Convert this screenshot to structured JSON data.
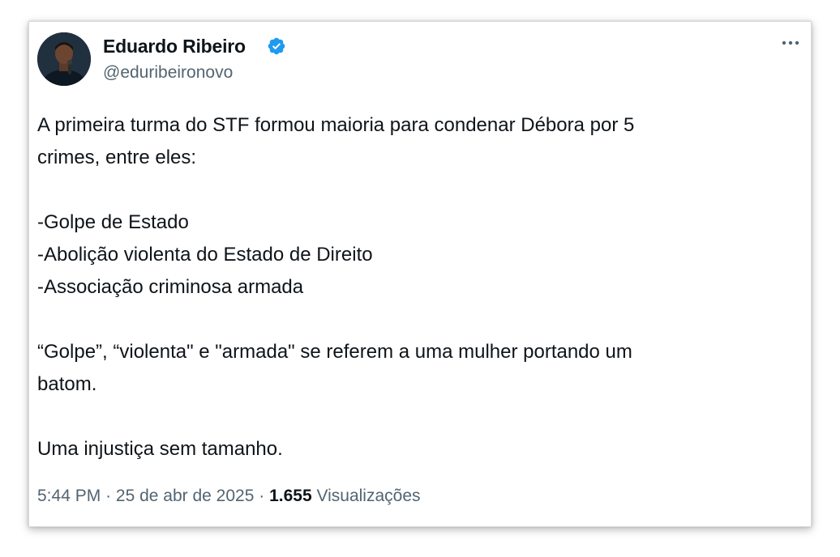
{
  "author": {
    "display_name": "Eduardo Ribeiro",
    "handle": "@eduribeironovo",
    "verified": true,
    "avatar_icon": "profile-photo-avatar"
  },
  "menu_icon": "more-horizontal-icon",
  "tweet": {
    "lines": [
      "A primeira turma do STF formou maioria para condenar Débora por 5",
      "crimes, entre eles:",
      "",
      "-Golpe de Estado",
      "-Abolição violenta do Estado de Direito",
      "-Associação criminosa armada",
      "",
      "“Golpe”, “violenta\" e \"armada\" se referem a uma mulher portando um",
      "batom.",
      "",
      "Uma injustiça sem tamanho."
    ]
  },
  "meta": {
    "time": "5:44 PM",
    "separator": "·",
    "date": "25 de abr de 2025",
    "views_count": "1.655",
    "views_label": "Visualizações"
  },
  "colors": {
    "text_primary": "#0f1419",
    "text_secondary": "#536471",
    "verified_blue": "#1d9bf0"
  }
}
